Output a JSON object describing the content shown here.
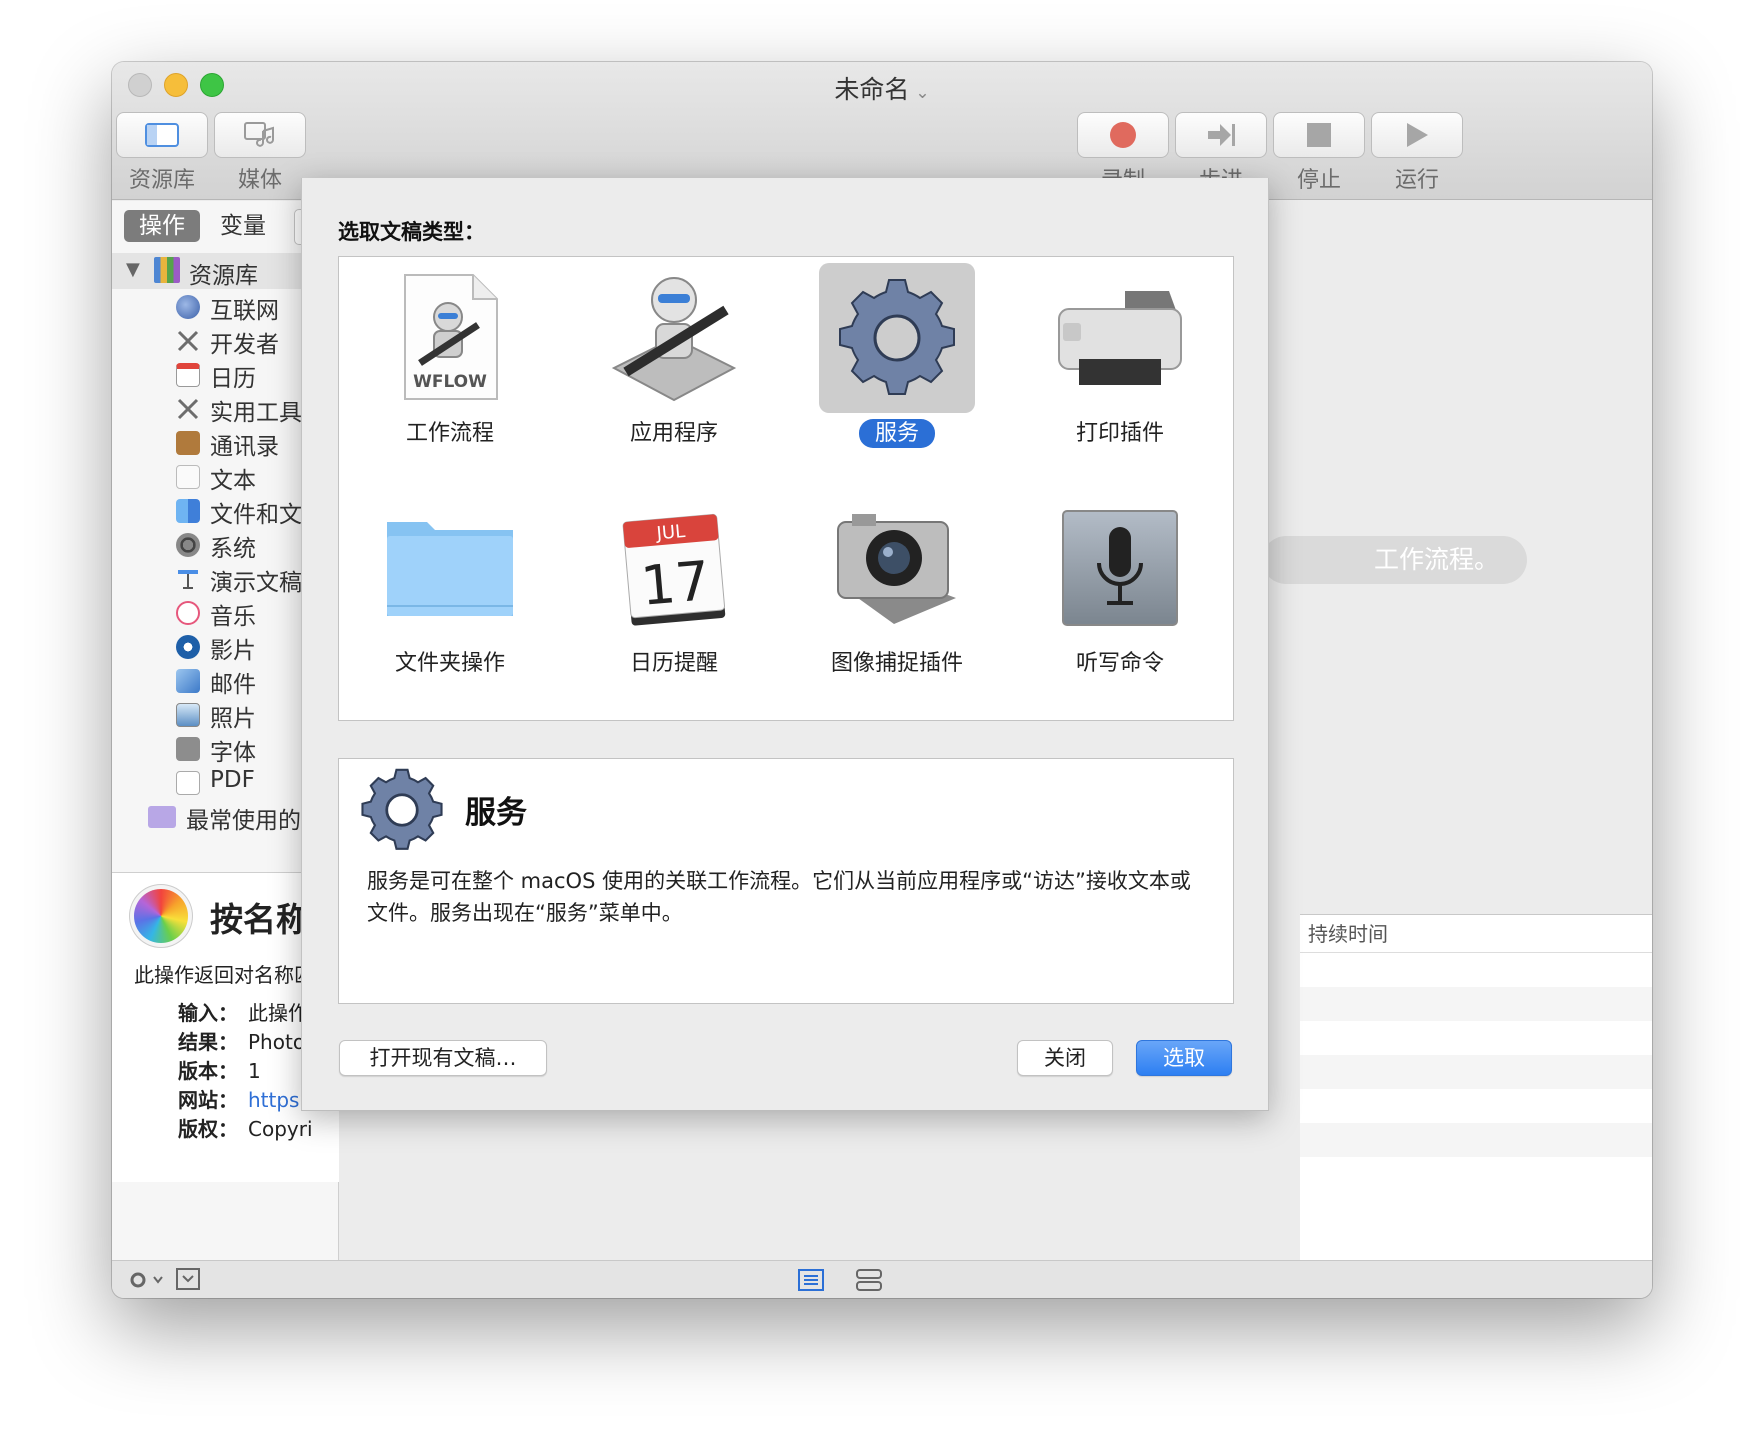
{
  "window": {
    "title": "未命名"
  },
  "toolbar": {
    "left": [
      {
        "label": "资源库"
      },
      {
        "label": "媒体"
      }
    ],
    "right": [
      {
        "label": "录制"
      },
      {
        "label": "步进"
      },
      {
        "label": "停止"
      },
      {
        "label": "运行"
      }
    ]
  },
  "sidebar": {
    "tabs": {
      "active": "操作",
      "inactive": "变量"
    },
    "library_label": "资源库",
    "categories": [
      "互联网",
      "开发者",
      "日历",
      "实用工具",
      "通讯录",
      "文本",
      "文件和文件",
      "系统",
      "演示文稿",
      "音乐",
      "影片",
      "邮件",
      "照片",
      "字体",
      "PDF"
    ],
    "recent": "最常使用的"
  },
  "info": {
    "title": "按名称获",
    "desc": "此操作返回对名称匹配",
    "rows": [
      {
        "k": "输入：",
        "v": "此操作不"
      },
      {
        "k": "结果：",
        "v": "Photos"
      },
      {
        "k": "版本：",
        "v": "1"
      },
      {
        "k": "网站：",
        "v": "https://"
      },
      {
        "k": "版权：",
        "v": "Copyri"
      }
    ]
  },
  "canvas": {
    "hint": "工作流程。"
  },
  "log": {
    "header": "持续时间"
  },
  "sheet": {
    "heading": "选取文稿类型：",
    "types": [
      {
        "label": "工作流程",
        "art": "WFLOW"
      },
      {
        "label": "应用程序"
      },
      {
        "label": "服务",
        "selected": true
      },
      {
        "label": "打印插件"
      },
      {
        "label": "文件夹操作"
      },
      {
        "label": "日历提醒",
        "month": "JUL",
        "day": "17"
      },
      {
        "label": "图像捕捉插件"
      },
      {
        "label": "听写命令"
      }
    ],
    "description": {
      "title": "服务",
      "text": "服务是可在整个 macOS 使用的关联工作流程。它们从当前应用程序或“访达”接收文本或文件。服务出现在“服务”菜单中。"
    },
    "buttons": {
      "open": "打开现有文稿…",
      "close": "关闭",
      "choose": "选取"
    }
  },
  "colors": {
    "accent": "#2b6fd6",
    "record": "#e06a5e"
  }
}
